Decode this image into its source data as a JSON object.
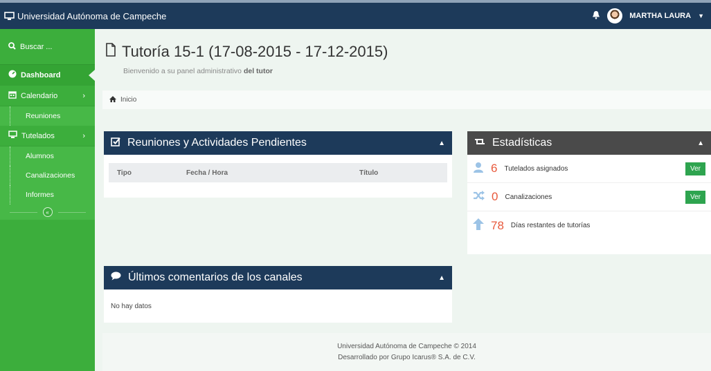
{
  "app": {
    "title": "Universidad Autónoma de Campeche",
    "user_name": "MARTHA LAURA"
  },
  "sidebar": {
    "search_label": "Buscar ...",
    "items": [
      {
        "label": "Dashboard"
      },
      {
        "label": "Calendario"
      },
      {
        "label": "Reuniones"
      },
      {
        "label": "Tutelados"
      },
      {
        "label": "Alumnos"
      },
      {
        "label": "Canalizaciones"
      },
      {
        "label": "Informes"
      }
    ]
  },
  "page": {
    "title": "Tutoría 15-1 (17-08-2015 - 17-12-2015)",
    "subtitle_prefix": "Bienvenido a su panel administrativo",
    "subtitle_bold": "del tutor",
    "breadcrumb": "Inicio"
  },
  "pending": {
    "title": "Reuniones y Actividades Pendientes",
    "columns": [
      "Tipo",
      "Fecha / Hora",
      "Título"
    ]
  },
  "comments": {
    "title": "Últimos comentarios de los canales",
    "empty": "No hay datos"
  },
  "stats": {
    "title": "Estadísticas",
    "rows": [
      {
        "icon": "user-icon",
        "value": "6",
        "label": "Tutelados asignados",
        "button": "Ver",
        "color": "#9cc3e6"
      },
      {
        "icon": "shuffle-icon",
        "value": "0",
        "label": "Canalizaciones",
        "button": "Ver",
        "color": "#9cc3e6"
      },
      {
        "icon": "arrow-up-icon",
        "value": "78",
        "label": "Días restantes de tutorías",
        "color": "#9cc3e6"
      }
    ]
  },
  "footer": {
    "line1": "Universidad Autónoma de Campeche © 2014",
    "line2": "Desarrollado por Grupo Icarus® S.A. de C.V."
  },
  "colors": {
    "topbar": "#1d3a5a",
    "sidebar": "#3cae3c",
    "accent_number": "#e8593c",
    "button_green": "#2ea44f"
  }
}
